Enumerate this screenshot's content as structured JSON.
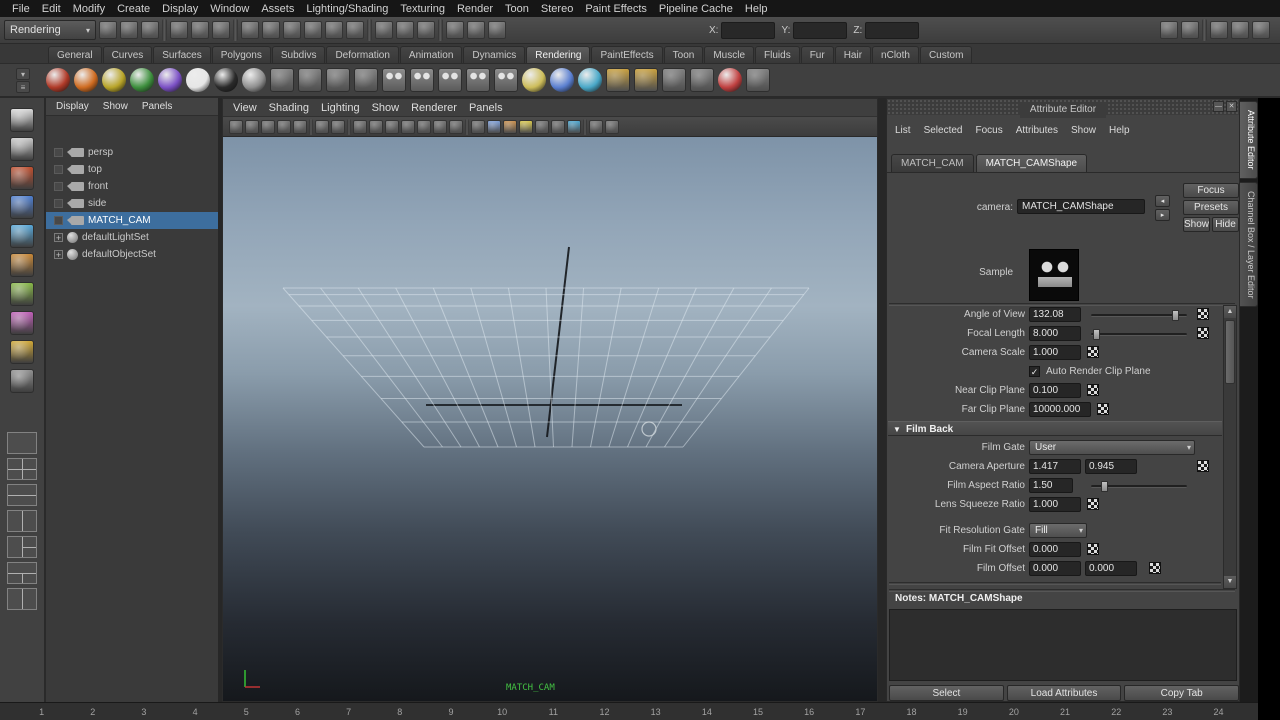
{
  "window": {
    "selection_color": "#3d6e9e",
    "hud_color": "#43c143"
  },
  "menubar": {
    "items": [
      "File",
      "Edit",
      "Modify",
      "Create",
      "Display",
      "Window",
      "Assets",
      "Lighting/Shading",
      "Texturing",
      "Render",
      "Toon",
      "Stereo",
      "Paint Effects",
      "Pipeline Cache",
      "Help"
    ]
  },
  "statusline": {
    "menu_set": "Rendering",
    "left_icons": [
      {
        "name": "new-scene-icon"
      },
      {
        "name": "open-scene-icon"
      },
      {
        "name": "save-scene-icon"
      },
      {
        "cls": "sp"
      },
      {
        "name": "select-by-hierarchy-icon"
      },
      {
        "name": "select-by-object-type-icon"
      },
      {
        "name": "select-by-component-type-icon"
      },
      {
        "cls": "sp"
      },
      {
        "name": "snap-to-grid-icon"
      },
      {
        "name": "snap-to-curve-icon"
      },
      {
        "name": "snap-to-point-icon"
      },
      {
        "name": "snap-to-projected-center-icon"
      },
      {
        "name": "snap-to-view-plane-icon"
      },
      {
        "name": "make-live-icon"
      },
      {
        "cls": "sp"
      },
      {
        "name": "input-connections-icon"
      },
      {
        "name": "output-connections-icon"
      },
      {
        "name": "construction-history-icon"
      },
      {
        "cls": "sp"
      },
      {
        "name": "render-current-frame-icon"
      },
      {
        "name": "ipr-render-icon"
      },
      {
        "name": "render-settings-icon"
      }
    ],
    "coord_fields": [
      {
        "label": "X:"
      },
      {
        "label": "Y:"
      },
      {
        "label": "Z:"
      }
    ],
    "right_icons": [
      {
        "name": "quick-selection-icon"
      },
      {
        "name": "numeric-input-icon"
      },
      {
        "cls": "sp"
      },
      {
        "name": "channel-box-toggle-icon"
      },
      {
        "name": "attribute-editor-toggle-icon"
      },
      {
        "name": "tool-settings-toggle-icon"
      }
    ]
  },
  "shelf": {
    "tabs": [
      {
        "label": "General"
      },
      {
        "label": "Curves"
      },
      {
        "label": "Surfaces"
      },
      {
        "label": "Polygons"
      },
      {
        "label": "Subdivs"
      },
      {
        "label": "Deformation"
      },
      {
        "label": "Animation"
      },
      {
        "label": "Dynamics"
      },
      {
        "label": "Rendering",
        "active": true
      },
      {
        "label": "PaintEffects"
      },
      {
        "label": "Toon"
      },
      {
        "label": "Muscle"
      },
      {
        "label": "Fluids"
      },
      {
        "label": "Fur"
      },
      {
        "label": "Hair"
      },
      {
        "label": "nCloth"
      },
      {
        "label": "Custom"
      }
    ],
    "icons": [
      {
        "name": "anisotropic-material-icon",
        "cls": "ball",
        "color": "#b03a28"
      },
      {
        "name": "blinn-material-icon",
        "cls": "ball",
        "color": "#cf6b20"
      },
      {
        "name": "lambert-material-icon",
        "cls": "ball",
        "color": "#b8a428"
      },
      {
        "name": "phong-material-icon",
        "cls": "ball",
        "color": "#3d8f3d"
      },
      {
        "name": "ramp-shader-material-icon",
        "cls": "ball",
        "color": "#7b50c5"
      },
      {
        "name": "surface-shader-material-icon",
        "cls": "ball",
        "color": "#e6e6e6"
      },
      {
        "name": "use-background-material-icon",
        "cls": "ball",
        "color": "#2a2a2a"
      },
      {
        "name": "shading-map-material-icon",
        "cls": "ball",
        "color": "#8f8f8f"
      },
      {
        "name": "checker-texture-icon",
        "cls": "flat"
      },
      {
        "name": "file-texture-icon",
        "cls": "flat"
      },
      {
        "name": "ramp-texture-icon",
        "cls": "flat"
      },
      {
        "name": "noise-texture-icon",
        "cls": "flat"
      },
      {
        "name": "render-scene-icon",
        "cls": "slate"
      },
      {
        "name": "ipr-render-shelf-icon",
        "cls": "slate"
      },
      {
        "name": "render-settings-shelf-icon",
        "cls": "slate"
      },
      {
        "name": "hypershade-icon",
        "cls": "slate"
      },
      {
        "name": "render-view-icon",
        "cls": "slate"
      },
      {
        "name": "ambient-light-icon",
        "cls": "ball",
        "color": "#cdbd5a"
      },
      {
        "name": "directional-light-icon",
        "cls": "ball",
        "color": "#5a7fd0"
      },
      {
        "name": "point-light-icon",
        "cls": "ball",
        "color": "#49a8c8"
      },
      {
        "name": "spot-light-icon",
        "cls": "flat",
        "color": "#c8a040"
      },
      {
        "name": "area-light-icon",
        "cls": "flat",
        "color": "#c8a040"
      },
      {
        "name": "volume-light-icon",
        "cls": "flat"
      },
      {
        "name": "shadows-shelf-icon",
        "cls": "flat"
      },
      {
        "name": "mental-ray-icon",
        "cls": "ball",
        "color": "#c04040"
      },
      {
        "name": "render-layers-icon",
        "cls": "flat"
      }
    ]
  },
  "toolbox": {
    "tools": [
      {
        "name": "select-tool",
        "color": "#d8d8d8"
      },
      {
        "name": "lasso-select-tool",
        "color": "#c8c8c8"
      },
      {
        "name": "paint-select-tool",
        "color": "#c05030"
      },
      {
        "name": "move-tool",
        "color": "#4f7fd0"
      },
      {
        "name": "rotate-tool",
        "color": "#58a8d8"
      },
      {
        "name": "scale-tool",
        "color": "#c88838"
      },
      {
        "name": "universal-manipulator-tool",
        "color": "#88b848"
      },
      {
        "name": "soft-modification-tool",
        "color": "#c060b8"
      },
      {
        "name": "show-manipulator-tool",
        "color": "#d0a838"
      },
      {
        "name": "last-tool-used",
        "color": "#909090"
      }
    ],
    "layouts": [
      {
        "name": "layout-single-pane",
        "cls": "l1"
      },
      {
        "name": "layout-four-pane",
        "cls": "l4"
      },
      {
        "name": "layout-two-stacked",
        "cls": "l2h"
      },
      {
        "name": "layout-two-side-by-side",
        "cls": "l2v"
      },
      {
        "name": "layout-three-split-left",
        "cls": "l3l"
      },
      {
        "name": "layout-three-split-top",
        "cls": "l3t"
      },
      {
        "name": "layout-outliner-persp",
        "cls": "l2v"
      }
    ]
  },
  "outliner": {
    "menus": [
      "Display",
      "Show",
      "Panels"
    ],
    "items": [
      {
        "label": "persp",
        "cls": "camera"
      },
      {
        "label": "top",
        "cls": "camera"
      },
      {
        "label": "front",
        "cls": "camera"
      },
      {
        "label": "side",
        "cls": "camera"
      },
      {
        "label": "MATCH_CAM",
        "cls": "camera",
        "selected": true
      },
      {
        "label": "defaultLightSet",
        "cls": "set"
      },
      {
        "label": "defaultObjectSet",
        "cls": "set"
      }
    ]
  },
  "viewport": {
    "menus": [
      "View",
      "Shading",
      "Lighting",
      "Show",
      "Renderer",
      "Panels"
    ],
    "toolbar_icons": [
      {
        "name": "select-camera-icon"
      },
      {
        "name": "lock-camera-icon"
      },
      {
        "name": "camera-attributes-icon"
      },
      {
        "name": "bookmark-icon"
      },
      {
        "name": "image-plane-icon"
      },
      {
        "cls": "sp"
      },
      {
        "name": "2d-pan-zoom-icon"
      },
      {
        "name": "grease-pencil-icon"
      },
      {
        "cls": "sp"
      },
      {
        "name": "grid-icon"
      },
      {
        "name": "film-gate-icon"
      },
      {
        "name": "resolution-gate-icon"
      },
      {
        "name": "gate-mask-icon"
      },
      {
        "name": "field-chart-icon"
      },
      {
        "name": "safe-action-icon"
      },
      {
        "name": "safe-title-icon"
      },
      {
        "cls": "sp"
      },
      {
        "name": "wireframe-icon"
      },
      {
        "name": "smooth-shade-icon",
        "color": "#7f9fd8"
      },
      {
        "name": "textured-icon",
        "color": "#c89050"
      },
      {
        "name": "use-all-lights-icon",
        "color": "#d8c850"
      },
      {
        "name": "shadows-icon"
      },
      {
        "name": "screen-space-ao-icon"
      },
      {
        "name": "motion-blur-icon",
        "color": "#50a8d0"
      },
      {
        "cls": "sp"
      },
      {
        "name": "xray-icon"
      },
      {
        "name": "isolate-select-icon"
      }
    ],
    "hud": "MATCH_CAM"
  },
  "attribute_editor": {
    "title": "Attribute Editor",
    "menus": [
      "List",
      "Selected",
      "Focus",
      "Attributes",
      "Show",
      "Help"
    ],
    "tabs": [
      {
        "label": "MATCH_CAM"
      },
      {
        "label": "MATCH_CAMShape",
        "active": true
      }
    ],
    "camera": {
      "label": "camera:",
      "value": "MATCH_CAMShape"
    },
    "actions": {
      "focus": "Focus",
      "presets": "Presets",
      "show": "Show",
      "hide": "Hide"
    },
    "sample_label": "Sample",
    "rows": {
      "angle_of_view": {
        "label": "Angle of View",
        "value": "132.08"
      },
      "focal_length": {
        "label": "Focal Length",
        "value": "8.000"
      },
      "camera_scale": {
        "label": "Camera Scale",
        "value": "1.000"
      },
      "auto_render_clip": {
        "label": "Auto Render Clip Plane",
        "checked": true
      },
      "near_clip": {
        "label": "Near Clip Plane",
        "value": "0.100"
      },
      "far_clip": {
        "label": "Far Clip Plane",
        "value": "10000.000"
      }
    },
    "film_back": {
      "title": "Film Back",
      "film_gate": {
        "label": "Film Gate",
        "value": "User"
      },
      "camera_aperture": {
        "label": "Camera Aperture",
        "value1": "1.417",
        "value2": "0.945"
      },
      "film_aspect": {
        "label": "Film Aspect Ratio",
        "value": "1.50"
      },
      "lens_squeeze": {
        "label": "Lens Squeeze Ratio",
        "value": "1.000"
      },
      "fit_resolution_gate": {
        "label": "Fit Resolution Gate",
        "value": "Fill"
      },
      "film_fit_offset": {
        "label": "Film Fit Offset",
        "value": "0.000"
      },
      "film_offset": {
        "label": "Film Offset",
        "value1": "0.000",
        "value2": "0.000"
      }
    },
    "notes_label": "Notes: MATCH_CAMShape",
    "footer": [
      "Select",
      "Load Attributes",
      "Copy Tab"
    ]
  },
  "right_tabs": [
    {
      "label": "Attribute Editor",
      "active": true
    },
    {
      "label": "Channel Box / Layer Editor"
    }
  ],
  "timeline": {
    "frames": [
      "1",
      "2",
      "3",
      "4",
      "5",
      "6",
      "7",
      "8",
      "9",
      "10",
      "11",
      "12",
      "13",
      "14",
      "15",
      "16",
      "17",
      "18",
      "19",
      "20",
      "21",
      "22",
      "23",
      "24"
    ]
  }
}
